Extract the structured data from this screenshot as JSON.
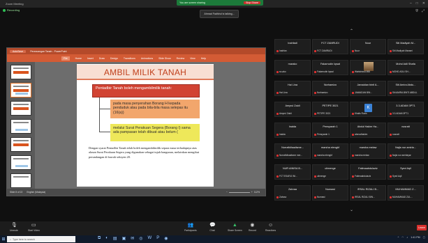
{
  "window": {
    "title": "Zoom Meeting"
  },
  "share_bar": {
    "label": "You are screen sharing",
    "stop_label": "Stop Share"
  },
  "meeting": {
    "label": "Recording"
  },
  "notification": {
    "text": "Ahmad Fadhirul is talking..."
  },
  "view_controls": [
    "View"
  ],
  "ppt": {
    "title_tabs": [
      "AutoSave",
      "Perancangan Tanah - PowerPoint"
    ],
    "ribbon_tabs": [
      "File",
      "Home",
      "Insert",
      "Draw",
      "Design",
      "Transitions",
      "Animations",
      "Slide Show",
      "Review",
      "View",
      "Help"
    ],
    "active_tab": "File",
    "status_left": "Slide 8 of 22",
    "status_mid": "English (Malaysia)",
    "zoom": "112%"
  },
  "slide": {
    "title": "AMBIL MILIK TANAH",
    "red_box": "Pentadbir Tanah boleh mengambilmilik tanah:",
    "orange_box": "pada masa penyerahan Borang H kepada penduduk atau pada bila-bila masa selepas itu (16(a))",
    "yellow_box": "melalui Surat Perakuan Segera (Borang I) sama ada pampasan telah dibuat atau belum (",
    "paragraph": "Dengan syarat Pentadbir Tanah telah boleh mengambilmilik separa masa terhadapnya atas alasan Surat Perakuan Segera yang digunakan sebagai tujuh bangunan, melainkan mengikut perundangan di bawah seksyen 20."
  },
  "participants": [
    {
      "name": "Inahfadi",
      "sub": "Inahfan"
    },
    {
      "name": "FCT ZAMRUDI",
      "sub": "FCT ZAMRUDI"
    },
    {
      "name": "Nuur",
      "sub": "Nuur"
    },
    {
      "name": "Siti Madiyah M...",
      "sub": "Siti Madiyah Marami"
    },
    {
      "name": "marako",
      "sub": "sn-ako"
    },
    {
      "name": "Fakarrudin Iqwal",
      "sub": "Fakarrudin Iqwal"
    },
    {
      "name": "",
      "sub": "Wahtdrizul1955"
    },
    {
      "name": "Mohd Adli Shafa",
      "sub": "MOHD ADLI SH..."
    },
    {
      "name": "Hai Lina",
      "sub": "Hai Lina"
    },
    {
      "name": "Norhamizo",
      "sub": "Norhamizo"
    },
    {
      "name": "Jamaidan binti A...",
      "sub": "JAMAIDAN BIN..."
    },
    {
      "name": "Siti Amira Abdu...",
      "sub": "Siti AMIRA BINTI ABDUL"
    },
    {
      "name": "Amyrul Zaidi",
      "sub": "Amyrul Zaidi"
    },
    {
      "name": "PETIPE 3021",
      "sub": "PETIPE 3021"
    },
    {
      "name": "",
      "sub": "Khalis Ruxis"
    },
    {
      "name": "3.3.ADAM 3PT1",
      "sub": "3.3.ADAM 3PT1"
    },
    {
      "name": "Inaida",
      "sub": "Inaida"
    },
    {
      "name": "Pensyarah 1",
      "sub": "Pensyarah 1"
    },
    {
      "name": "Abdul Hakim Ha...",
      "sub": "ahmadhakim"
    },
    {
      "name": "nusratt",
      "sub": "nusratt"
    },
    {
      "name": "Nurrafidhaalisme...",
      "sub": "Nurrafidhaalisme mer..."
    },
    {
      "name": "marsha elengkf",
      "sub": "marsha elengkf"
    },
    {
      "name": "marsha melaw",
      "sub": "marsha melaw"
    },
    {
      "name": "Najla nur amirla...",
      "sub": "Najla nur amirlayar"
    },
    {
      "name": "NUR AINISA B...",
      "sub": "FCT ESARIJ INI..."
    },
    {
      "name": "ulimenge",
      "sub": "ulimenge"
    },
    {
      "name": "Fatimaabdulaziz",
      "sub": "Fatimaabdulaziz"
    },
    {
      "name": "Syed Aqil",
      "sub": "Syed Aqil"
    },
    {
      "name": "Zahraa",
      "sub": "Zahraa"
    },
    {
      "name": "Numawi",
      "sub": "Numawi"
    },
    {
      "name": "IRSAL RIZALI B...",
      "sub": "IRSAL RIZALI BIN..."
    },
    {
      "name": "MUHAMMAD Z...",
      "sub": "MUHAMMAD ZUL..."
    }
  ],
  "k_avatar_letter": "K",
  "toolbar": {
    "unmute": "Unmute",
    "start_video": "Start Video",
    "participants": "Participants",
    "participants_count": "45",
    "chat": "Chat",
    "share": "Share Screen",
    "record": "Record",
    "reactions": "Reactions",
    "end": "Leave"
  },
  "taskbar": {
    "search_placeholder": "Type here to search",
    "time": "1:41 PM"
  }
}
